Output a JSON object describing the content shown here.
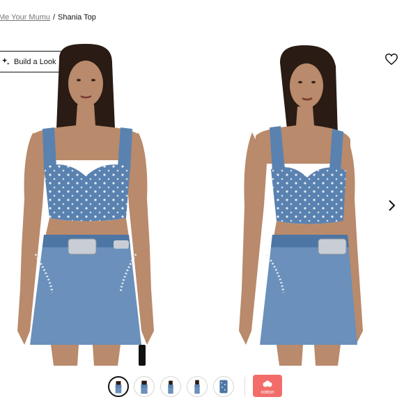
{
  "breadcrumb": {
    "parent": "Me Your Mumu",
    "separator": "/",
    "current": "Shania Top"
  },
  "build_look": {
    "label": "Build a Look",
    "icon": "sparkle-icon"
  },
  "icons": {
    "wishlist": "heart-icon",
    "next": "chevron-right-icon"
  },
  "images": [
    {
      "alt": "Shania Top front view"
    },
    {
      "alt": "Shania Top side view"
    }
  ],
  "thumbnails": {
    "count": 5,
    "active_index": 0
  },
  "badge": {
    "label": "cotton",
    "color": "#f26d6a"
  },
  "colors": {
    "denim": "#5a82b0",
    "denim_dark": "#3f6590",
    "skin": "#b98a6b",
    "hair": "#2a1b14",
    "stud": "#e8edf3"
  }
}
